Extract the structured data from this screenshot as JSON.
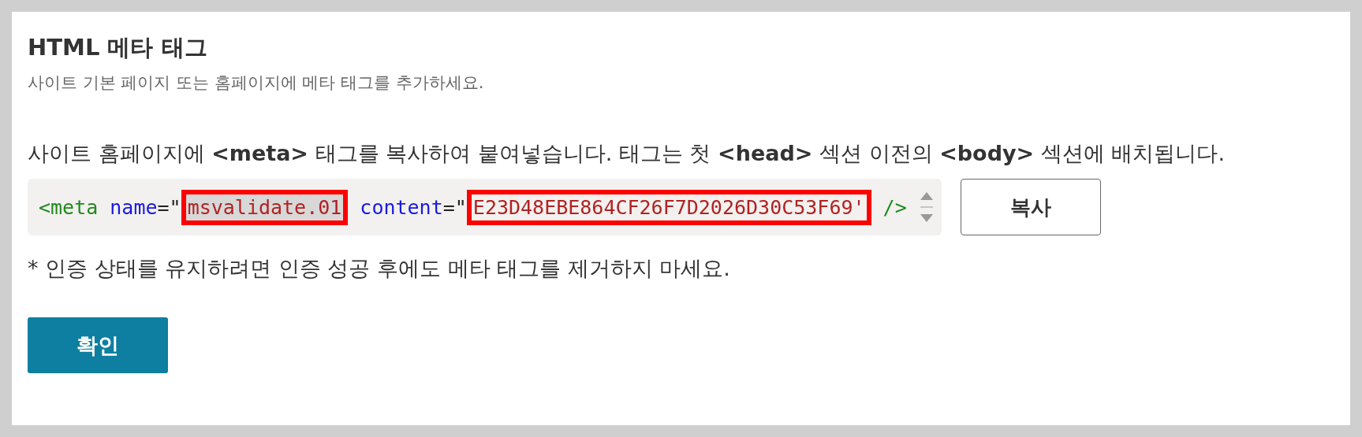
{
  "title": "HTML 메타 태그",
  "subtitle": "사이트 기본 페이지 또는 홈페이지에 메타 태그를 추가하세요.",
  "instruction": "사이트 홈페이지에 **<meta>** 태그를 복사하여 붙여넣습니다. 태그는 첫 **<head>** 섹션 이전의 **<body>** 섹션에 배치됩니다.",
  "code": [
    {
      "kind": "tag",
      "text": "<meta",
      "selected": false,
      "marked": false
    },
    {
      "kind": "attr",
      "text": " name",
      "selected": false,
      "marked": false
    },
    {
      "kind": "punct",
      "text": "=\"",
      "selected": false,
      "marked": false
    },
    {
      "kind": "value",
      "text": "msvalidate.01",
      "selected": true,
      "marked": true
    },
    {
      "kind": "attr",
      "text": " content",
      "selected": false,
      "marked": false
    },
    {
      "kind": "punct",
      "text": "=\"",
      "selected": false,
      "marked": false
    },
    {
      "kind": "value",
      "text": "E23D48EBE864CF26F7D2026D30C53F69'",
      "selected": false,
      "marked": true
    },
    {
      "kind": "tag",
      "text": " />",
      "selected": false,
      "marked": false
    }
  ],
  "copy_button": "복사",
  "note": "* 인증 상태를 유지하려면 인증 성공 후에도 메타 태그를 제거하지 마세요.",
  "confirm_button": "확인"
}
